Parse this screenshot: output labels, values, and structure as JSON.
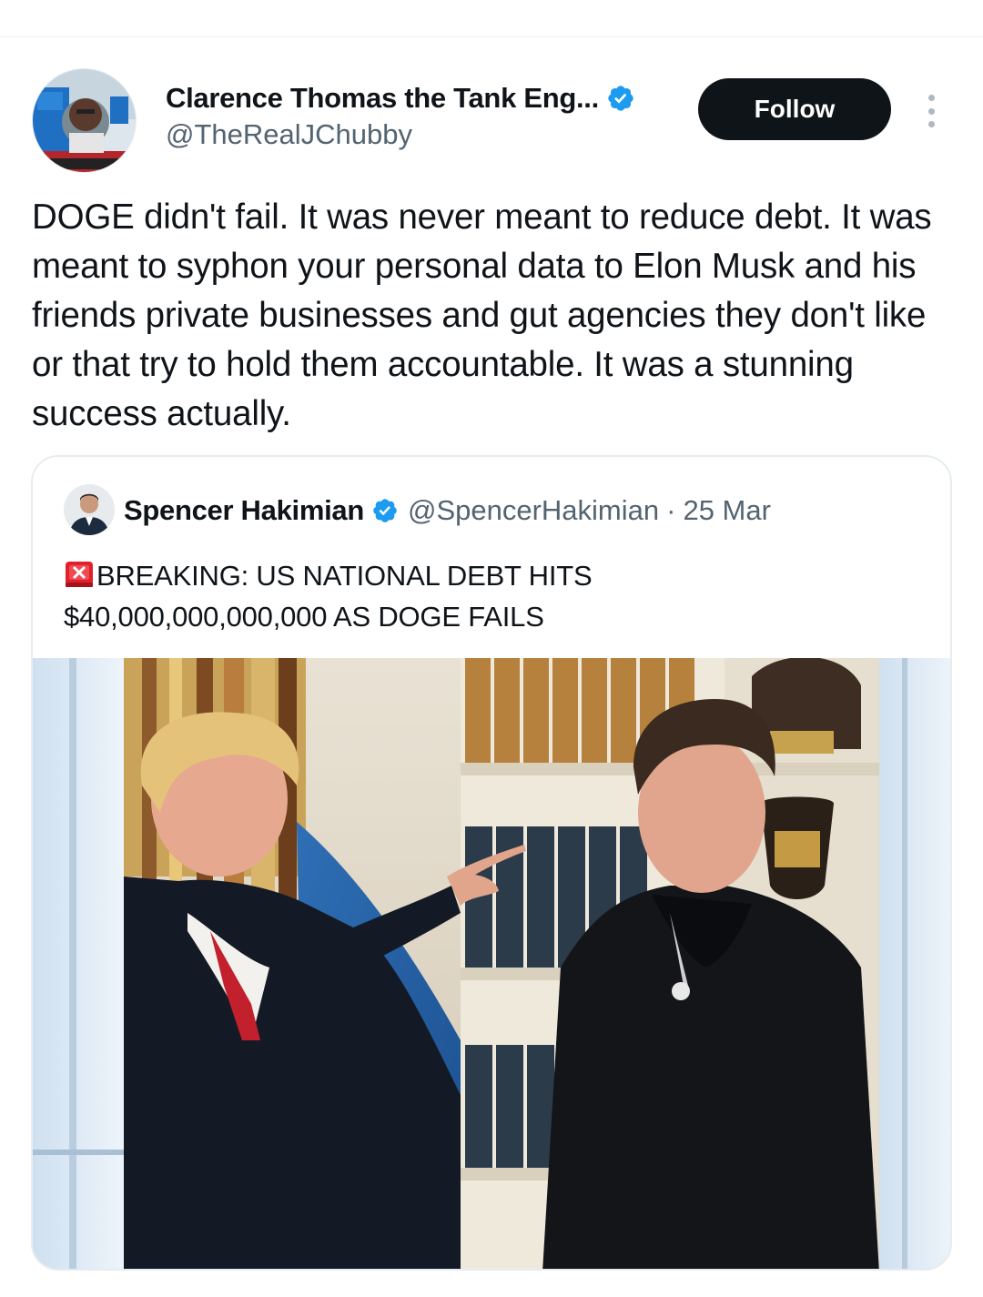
{
  "author": {
    "display_name": "Clarence Thomas the Tank Eng...",
    "handle": "@TheRealJChubby",
    "verified": true,
    "avatar_icon": "avatar-tank-engine"
  },
  "actions": {
    "follow_label": "Follow",
    "more_icon": "more-vertical-icon"
  },
  "tweet": {
    "text": "DOGE didn't fail. It was never meant to reduce debt. It was meant to syphon your personal data to Elon Musk and his friends private businesses and gut agencies they don't like or that try to hold them accountable. It was a stunning success actually."
  },
  "quote": {
    "display_name": "Spencer Hakimian",
    "handle": "@SpencerHakimian",
    "separator": "·",
    "date": "25 Mar",
    "verified": true,
    "emoji_icon": "siren-emoji",
    "text_line1": "BREAKING: US NATIONAL DEBT HITS",
    "text_line2": "$40,000,000,000,000 AS DOGE FAILS",
    "image_icon": "photo-two-men-office"
  },
  "colors": {
    "text_primary": "#0f1419",
    "text_secondary": "#536471",
    "verified_blue": "#1d9bf0",
    "follow_bg": "#0f1419",
    "card_border": "#e6ecf0"
  }
}
